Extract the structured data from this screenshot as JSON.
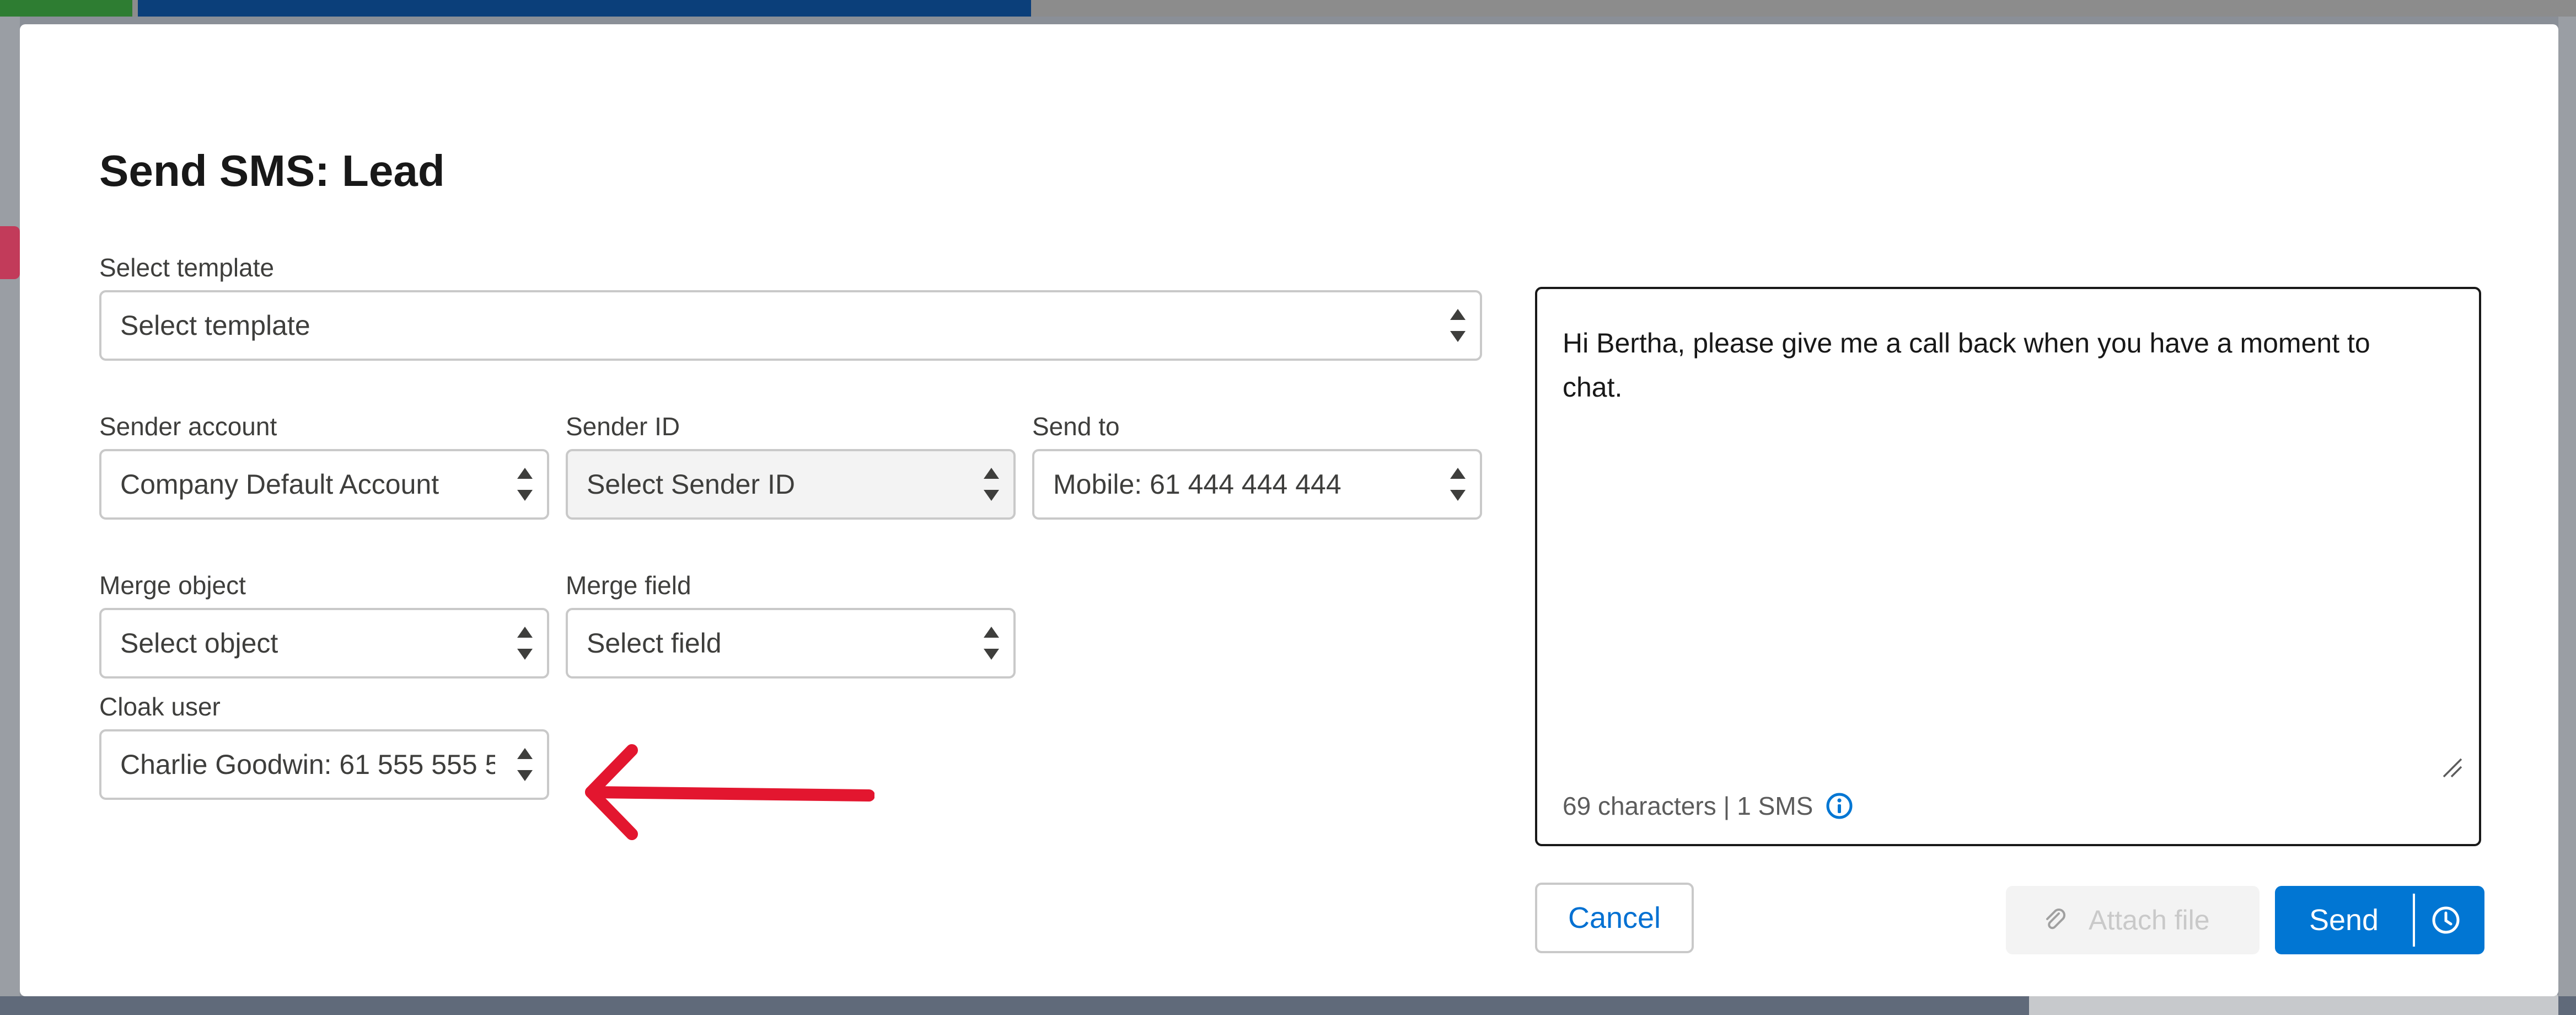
{
  "modal": {
    "title": "Send SMS: Lead"
  },
  "template": {
    "label": "Select template",
    "value": "Select template"
  },
  "sender_account": {
    "label": "Sender account",
    "value": "Company Default Account"
  },
  "sender_id": {
    "label": "Sender ID",
    "value": "Select Sender ID"
  },
  "send_to": {
    "label": "Send to",
    "value": "Mobile: 61 444 444 444"
  },
  "merge_object": {
    "label": "Merge object",
    "value": "Select object"
  },
  "merge_field": {
    "label": "Merge field",
    "value": "Select field"
  },
  "cloak_user": {
    "label": "Cloak user",
    "value": "Charlie Goodwin: 61 555 555 5"
  },
  "message": {
    "text": "Hi Bertha, please give me a call back when you have a moment to chat.",
    "counter": "69 characters | 1 SMS"
  },
  "buttons": {
    "cancel": "Cancel",
    "attach": "Attach file",
    "send": "Send"
  },
  "colors": {
    "brand_blue": "#0176d3",
    "annotation_arrow": "#e3162f"
  },
  "icons": {
    "info": "info-icon",
    "attach": "paperclip-icon",
    "schedule": "clock-icon",
    "stepper": "up-down-arrows-icon"
  }
}
